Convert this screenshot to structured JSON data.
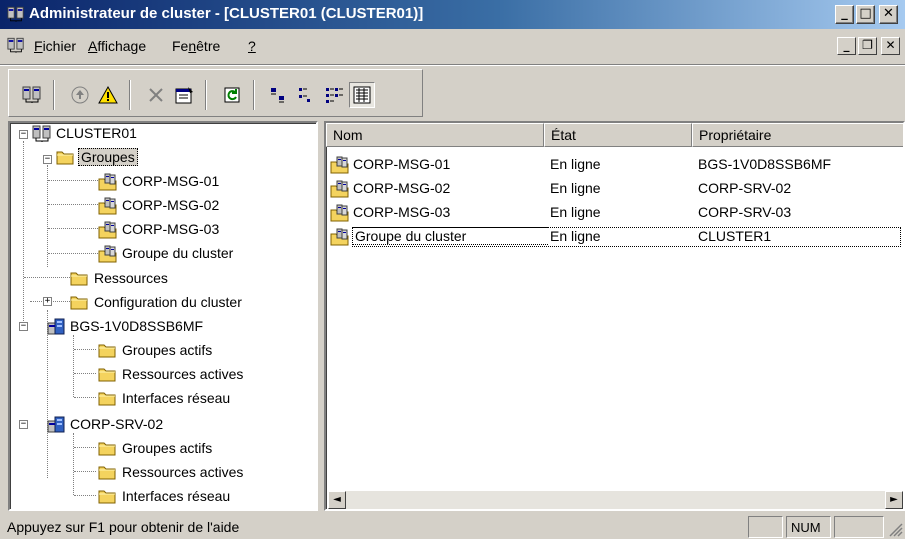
{
  "window": {
    "title": "Administrateur de cluster - [CLUSTER01 (CLUSTER01)]",
    "caption_buttons": [
      "_",
      "□",
      "✕"
    ]
  },
  "menu": {
    "items": [
      {
        "label_u": "F",
        "label_rest": "ichier"
      },
      {
        "label_u": "A",
        "label_rest": "ffichage"
      },
      {
        "label_pre": "Fe",
        "label_u": "n",
        "label_rest": "être"
      },
      {
        "label_u": "?",
        "label_rest": ""
      }
    ],
    "mdi_buttons": [
      "_",
      "❐",
      "✕"
    ]
  },
  "toolbar": {
    "icons": [
      "open-connection-icon",
      "bring-online-icon",
      "take-offline-icon",
      "delete-icon",
      "properties-icon",
      "refresh-icon",
      "large-icons-icon",
      "small-icons-icon",
      "list-view-icon",
      "details-view-icon"
    ]
  },
  "tree": {
    "root": "CLUSTER01",
    "groups": "Groupes",
    "group_items": [
      "CORP-MSG-01",
      "CORP-MSG-02",
      "CORP-MSG-03",
      "Groupe du cluster"
    ],
    "resources": "Ressources",
    "cluster_config": "Configuration du cluster",
    "nodes": [
      {
        "name": "BGS-1V0D8SSB6MF",
        "children": [
          "Groupes actifs",
          "Ressources actives",
          "Interfaces réseau"
        ]
      },
      {
        "name": "CORP-SRV-02",
        "children": [
          "Groupes actifs",
          "Ressources actives",
          "Interfaces réseau"
        ]
      }
    ],
    "expander_minus": "−",
    "expander_plus": "+"
  },
  "list": {
    "columns": [
      "Nom",
      "État",
      "Propriétaire"
    ],
    "rows": [
      {
        "name": "CORP-MSG-01",
        "state": "En ligne",
        "owner": "BGS-1V0D8SSB6MF"
      },
      {
        "name": "CORP-MSG-02",
        "state": "En ligne",
        "owner": "CORP-SRV-02"
      },
      {
        "name": "CORP-MSG-03",
        "state": "En ligne",
        "owner": "CORP-SRV-03"
      },
      {
        "name": "Groupe du cluster",
        "state": "En ligne",
        "owner": "CLUSTER1"
      }
    ],
    "scroll_left": "◄",
    "scroll_right": "►"
  },
  "status": {
    "text": "Appuyez sur F1 pour obtenir de l'aide",
    "num": "NUM"
  },
  "colors": {
    "title_gradient_start": "#0a246a",
    "title_gradient_end": "#a6caf0",
    "face": "#d4d0c8",
    "folder": "#f4d35e"
  }
}
